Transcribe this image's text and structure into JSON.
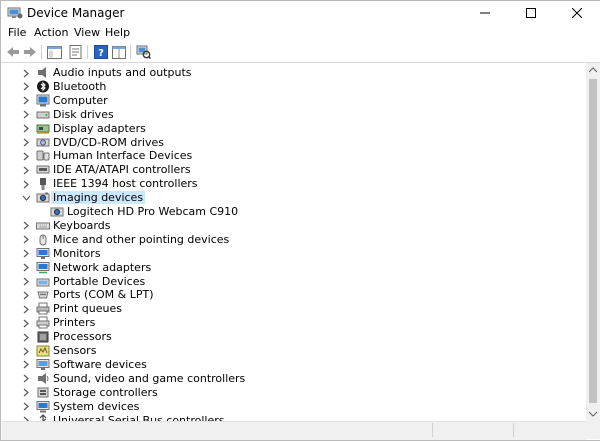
{
  "window": {
    "title": "Device Manager"
  },
  "menu": {
    "file": "File",
    "action": "Action",
    "view": "View",
    "help": "Help"
  },
  "toolbar": {
    "buttons": [
      "back-icon",
      "forward-icon",
      "console-tree-icon",
      "properties-icon",
      "help-icon",
      "view-icon",
      "scan-hardware-icon"
    ]
  },
  "tree": {
    "items": [
      {
        "label": "Audio inputs and outputs",
        "icon": "speaker-icon",
        "expanded": false
      },
      {
        "label": "Bluetooth",
        "icon": "bluetooth-icon",
        "expanded": false
      },
      {
        "label": "Computer",
        "icon": "computer-icon",
        "expanded": false
      },
      {
        "label": "Disk drives",
        "icon": "disk-drive-icon",
        "expanded": false
      },
      {
        "label": "Display adapters",
        "icon": "display-adapter-icon",
        "expanded": false
      },
      {
        "label": "DVD/CD-ROM drives",
        "icon": "dvd-drive-icon",
        "expanded": false
      },
      {
        "label": "Human Interface Devices",
        "icon": "hid-icon",
        "expanded": false
      },
      {
        "label": "IDE ATA/ATAPI controllers",
        "icon": "ide-controller-icon",
        "expanded": false
      },
      {
        "label": "IEEE 1394 host controllers",
        "icon": "ieee1394-icon",
        "expanded": false
      },
      {
        "label": "Imaging devices",
        "icon": "camera-icon",
        "expanded": true,
        "selected": true
      },
      {
        "label": "Logitech HD Pro Webcam C910",
        "icon": "webcam-icon",
        "child": true
      },
      {
        "label": "Keyboards",
        "icon": "keyboard-icon",
        "expanded": false
      },
      {
        "label": "Mice and other pointing devices",
        "icon": "mouse-icon",
        "expanded": false
      },
      {
        "label": "Monitors",
        "icon": "monitor-icon",
        "expanded": false
      },
      {
        "label": "Network adapters",
        "icon": "network-adapter-icon",
        "expanded": false
      },
      {
        "label": "Portable Devices",
        "icon": "portable-device-icon",
        "expanded": false
      },
      {
        "label": "Ports (COM & LPT)",
        "icon": "port-icon",
        "expanded": false
      },
      {
        "label": "Print queues",
        "icon": "printer-queue-icon",
        "expanded": false
      },
      {
        "label": "Printers",
        "icon": "printer-icon",
        "expanded": false
      },
      {
        "label": "Processors",
        "icon": "processor-icon",
        "expanded": false
      },
      {
        "label": "Sensors",
        "icon": "sensor-icon",
        "expanded": false
      },
      {
        "label": "Software devices",
        "icon": "software-device-icon",
        "expanded": false
      },
      {
        "label": "Sound, video and game controllers",
        "icon": "sound-controller-icon",
        "expanded": false
      },
      {
        "label": "Storage controllers",
        "icon": "storage-controller-icon",
        "expanded": false
      },
      {
        "label": "System devices",
        "icon": "system-device-icon",
        "expanded": false
      },
      {
        "label": "Universal Serial Bus controllers",
        "icon": "usb-icon",
        "expanded": false
      }
    ]
  },
  "colors": {
    "selection": "#cce8ff",
    "icon_blue": "#2b78d0",
    "chevron": "#595959"
  }
}
